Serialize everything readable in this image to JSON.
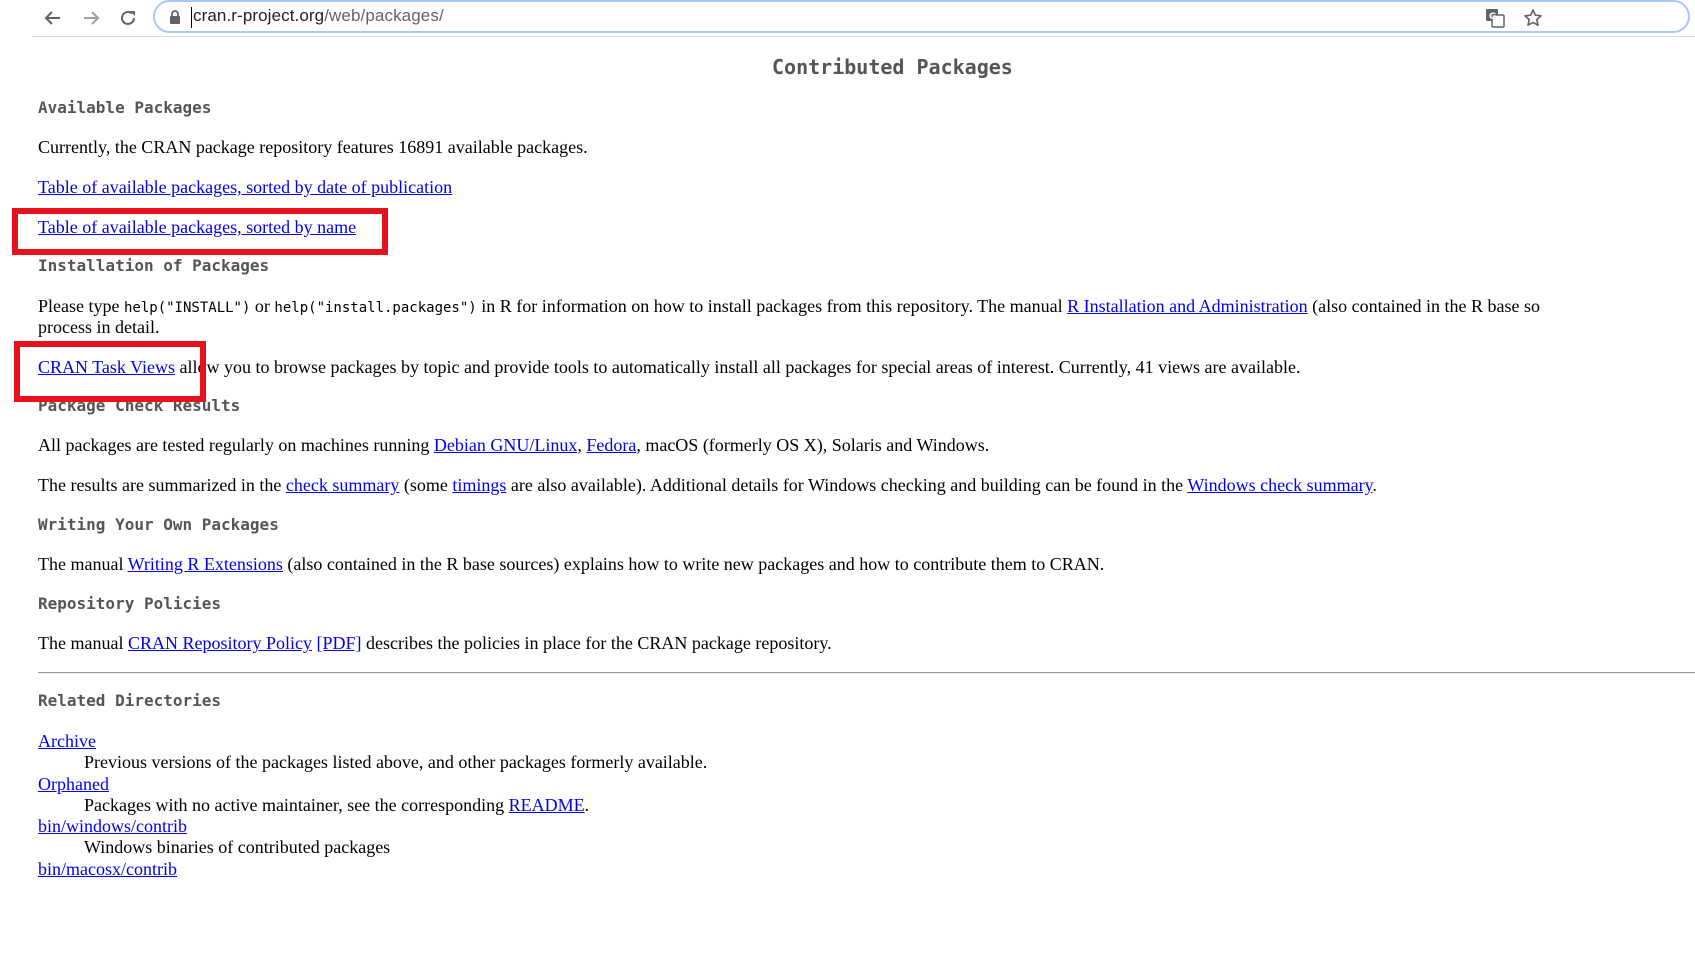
{
  "browser": {
    "url_domain": "cran.r-project.org",
    "url_path": "/web/packages/",
    "icons": [
      "back-icon",
      "forward-icon",
      "reload-icon",
      "lock-icon",
      "translate-icon",
      "star-icon"
    ]
  },
  "page": {
    "title": "Contributed Packages",
    "available": {
      "heading": "Available Packages",
      "text": "Currently, the CRAN package repository features 16891 available packages.",
      "link_date": "Table of available packages, sorted by date of publication",
      "link_name": "Table of available packages, sorted by name"
    },
    "installation": {
      "heading": "Installation of Packages",
      "t1": "Please type ",
      "code1": "help(\"INSTALL\")",
      "t2": " or ",
      "code2": "help(\"install.packages\")",
      "t3": " in R for information on how to install packages from this repository. The manual ",
      "link_manual": "R Installation and Administration",
      "t4": " (also contained in the R base so",
      "line2": "process in detail.",
      "task_views_link": "CRAN Task Views",
      "task_views_text": " allow you to browse packages by topic and provide tools to automatically install all packages for special areas of interest. Currently, 41 views are available."
    },
    "check": {
      "heading": "Package Check Results",
      "t1": "All packages are tested regularly on machines running ",
      "link_debian": "Debian GNU/Linux",
      "sep": ", ",
      "link_fedora": "Fedora",
      "t2": ", macOS (formerly OS X), Solaris and Windows.",
      "r1": "The results are summarized in the ",
      "link_check": "check summary",
      "r2": " (some ",
      "link_timings": "timings",
      "r3": " are also available). Additional details for Windows checking and building can be found in the ",
      "link_win": "Windows check summary",
      "r4": "."
    },
    "writing": {
      "heading": "Writing Your Own Packages",
      "t1": "The manual ",
      "link": "Writing R Extensions",
      "t2": " (also contained in the R base sources) explains how to write new packages and how to contribute them to CRAN."
    },
    "policies": {
      "heading": "Repository Policies",
      "t1": "The manual ",
      "link": "CRAN Repository Policy",
      "sp": " ",
      "link_pdf": "[PDF]",
      "t2": " describes the policies in place for the CRAN package repository."
    },
    "related": {
      "heading": "Related Directories",
      "archive": "Archive",
      "archive_desc": "Previous versions of the packages listed above, and other packages formerly available.",
      "orphaned": "Orphaned",
      "orphaned_desc": "Packages with no active maintainer, see the corresponding ",
      "readme": "README",
      "orphaned_end": ".",
      "win": "bin/windows/contrib",
      "win_desc": "Windows binaries of contributed packages",
      "mac": "bin/macosx/contrib"
    }
  },
  "colors": {
    "highlight": "#e8101c",
    "link": "#0000ee",
    "heading": "#555555"
  }
}
